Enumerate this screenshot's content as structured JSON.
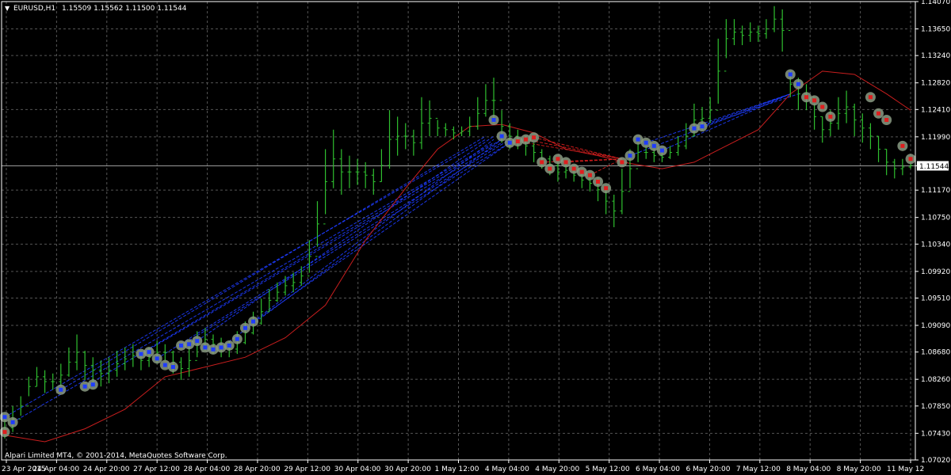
{
  "header": {
    "symbol": "EURUSD,H1",
    "ohlc": "1.15509 1.15562 1.11500 1.11544"
  },
  "footer": {
    "copyright": "Alpari Limited MT4, © 2001-2014, MetaQuotes Software Corp."
  },
  "colors": {
    "background": "#000000",
    "grid": "#555555",
    "bull_bar": "#2fbf2f",
    "bear_bar": "#2fbf2f",
    "envelope": "#c81e1e",
    "buy_marker": "#1e3cff",
    "sell_marker": "#e01e1e",
    "marker_halo": "#8a9a82",
    "current_price_box": "#ffffff"
  },
  "chart_data": {
    "type": "line",
    "symbol": "EURUSD",
    "timeframe": "H1",
    "current_price": 1.11544,
    "ylim": [
      1.0702,
      1.1407
    ],
    "y_ticks": [
      "1.14070",
      "1.13650",
      "1.13240",
      "1.12820",
      "1.12410",
      "1.11990",
      "1.11544",
      "1.11170",
      "1.10750",
      "1.10340",
      "1.09920",
      "1.09510",
      "1.09090",
      "1.08680",
      "1.08260",
      "1.07850",
      "1.07430",
      "1.07020"
    ],
    "x_ticks": [
      "23 Apr 2015",
      "24 Apr 04:00",
      "24 Apr 20:00",
      "27 Apr 12:00",
      "28 Apr 04:00",
      "28 Apr 20:00",
      "29 Apr 12:00",
      "30 Apr 04:00",
      "30 Apr 20:00",
      "1 May 12:00",
      "4 May 04:00",
      "4 May 20:00",
      "5 May 12:00",
      "6 May 04:00",
      "6 May 20:00",
      "7 May 12:00",
      "8 May 04:00",
      "8 May 20:00",
      "11 May 12"
    ],
    "series": [
      {
        "kind": "price_hl",
        "values": [
          [
            0,
            1.0768,
            1.0735
          ],
          [
            1,
            1.0785,
            1.0745
          ],
          [
            2,
            1.08,
            1.077
          ],
          [
            3,
            1.083,
            1.08
          ],
          [
            4,
            1.0845,
            1.0815
          ],
          [
            5,
            1.084,
            1.0805
          ],
          [
            6,
            1.0835,
            1.081
          ],
          [
            7,
            1.085,
            1.0815
          ],
          [
            8,
            1.0875,
            1.083
          ],
          [
            9,
            1.0895,
            1.084
          ],
          [
            10,
            1.087,
            1.0825
          ],
          [
            11,
            1.086,
            1.082
          ],
          [
            12,
            1.0855,
            1.0815
          ],
          [
            13,
            1.086,
            1.082
          ],
          [
            14,
            1.087,
            1.083
          ],
          [
            15,
            1.0875,
            1.084
          ],
          [
            16,
            1.088,
            1.0845
          ],
          [
            17,
            1.087,
            1.084
          ],
          [
            18,
            1.0875,
            1.0845
          ],
          [
            19,
            1.0885,
            1.085
          ],
          [
            20,
            1.088,
            1.0855
          ],
          [
            21,
            1.087,
            1.0835
          ],
          [
            22,
            1.086,
            1.0825
          ],
          [
            23,
            1.088,
            1.083
          ],
          [
            24,
            1.09,
            1.086
          ],
          [
            25,
            1.0905,
            1.087
          ],
          [
            26,
            1.0895,
            1.0865
          ],
          [
            27,
            1.089,
            1.086
          ],
          [
            28,
            1.0885,
            1.086
          ],
          [
            29,
            1.09,
            1.0865
          ],
          [
            30,
            1.0915,
            1.088
          ],
          [
            31,
            1.093,
            1.0895
          ],
          [
            32,
            1.095,
            1.091
          ],
          [
            33,
            1.0965,
            1.093
          ],
          [
            34,
            1.0975,
            1.0945
          ],
          [
            35,
            1.0985,
            1.0955
          ],
          [
            36,
            1.099,
            1.096
          ],
          [
            37,
            1.1,
            1.097
          ],
          [
            38,
            1.104,
            1.099
          ],
          [
            39,
            1.11,
            1.103
          ],
          [
            40,
            1.118,
            1.108
          ],
          [
            41,
            1.121,
            1.112
          ],
          [
            42,
            1.118,
            1.111
          ],
          [
            43,
            1.117,
            1.112
          ],
          [
            44,
            1.1165,
            1.1125
          ],
          [
            45,
            1.116,
            1.112
          ],
          [
            46,
            1.115,
            1.111
          ],
          [
            47,
            1.118,
            1.113
          ],
          [
            48,
            1.124,
            1.115
          ],
          [
            49,
            1.123,
            1.117
          ],
          [
            50,
            1.122,
            1.118
          ],
          [
            51,
            1.121,
            1.117
          ],
          [
            52,
            1.126,
            1.118
          ],
          [
            53,
            1.1255,
            1.12
          ],
          [
            54,
            1.1225,
            1.12
          ],
          [
            55,
            1.122,
            1.12
          ],
          [
            56,
            1.1215,
            1.1195
          ],
          [
            57,
            1.1215,
            1.12
          ],
          [
            58,
            1.123,
            1.12
          ],
          [
            59,
            1.126,
            1.121
          ],
          [
            60,
            1.128,
            1.123
          ],
          [
            61,
            1.129,
            1.122
          ],
          [
            62,
            1.124,
            1.119
          ],
          [
            63,
            1.122,
            1.118
          ],
          [
            64,
            1.121,
            1.118
          ],
          [
            65,
            1.12,
            1.117
          ],
          [
            66,
            1.119,
            1.116
          ],
          [
            67,
            1.118,
            1.115
          ],
          [
            68,
            1.117,
            1.114
          ],
          [
            69,
            1.116,
            1.113
          ],
          [
            70,
            1.116,
            1.1135
          ],
          [
            71,
            1.115,
            1.113
          ],
          [
            72,
            1.1145,
            1.112
          ],
          [
            73,
            1.114,
            1.1115
          ],
          [
            74,
            1.1135,
            1.11
          ],
          [
            75,
            1.112,
            1.108
          ],
          [
            76,
            1.111,
            1.106
          ],
          [
            77,
            1.115,
            1.108
          ],
          [
            78,
            1.118,
            1.112
          ],
          [
            79,
            1.119,
            1.116
          ],
          [
            80,
            1.1185,
            1.1165
          ],
          [
            81,
            1.118,
            1.116
          ],
          [
            82,
            1.1175,
            1.116
          ],
          [
            83,
            1.1185,
            1.1165
          ],
          [
            84,
            1.12,
            1.117
          ],
          [
            85,
            1.122,
            1.118
          ],
          [
            86,
            1.125,
            1.12
          ],
          [
            87,
            1.1245,
            1.121
          ],
          [
            88,
            1.126,
            1.122
          ],
          [
            89,
            1.135,
            1.125
          ],
          [
            90,
            1.138,
            1.132
          ],
          [
            91,
            1.138,
            1.134
          ],
          [
            92,
            1.137,
            1.134
          ],
          [
            93,
            1.1375,
            1.1345
          ],
          [
            94,
            1.137,
            1.1345
          ],
          [
            95,
            1.138,
            1.135
          ],
          [
            96,
            1.14,
            1.136
          ],
          [
            97,
            1.1395,
            1.133
          ],
          [
            98,
            1.13,
            1.126
          ],
          [
            99,
            1.129,
            1.124
          ],
          [
            100,
            1.128,
            1.124
          ],
          [
            101,
            1.125,
            1.121
          ],
          [
            102,
            1.123,
            1.119
          ],
          [
            103,
            1.124,
            1.12
          ],
          [
            104,
            1.126,
            1.121
          ],
          [
            105,
            1.127,
            1.122
          ],
          [
            106,
            1.125,
            1.12
          ],
          [
            107,
            1.1235,
            1.119
          ],
          [
            108,
            1.122,
            1.118
          ],
          [
            109,
            1.12,
            1.116
          ],
          [
            110,
            1.118,
            1.114
          ],
          [
            111,
            1.1165,
            1.1135
          ],
          [
            112,
            1.1165,
            1.114
          ],
          [
            113,
            1.116,
            1.115
          ]
        ]
      }
    ],
    "envelope": [
      [
        0,
        1.074
      ],
      [
        5,
        1.073
      ],
      [
        10,
        1.075
      ],
      [
        15,
        1.078
      ],
      [
        20,
        1.083
      ],
      [
        25,
        1.0845
      ],
      [
        30,
        1.086
      ],
      [
        35,
        1.089
      ],
      [
        40,
        1.094
      ],
      [
        45,
        1.104
      ],
      [
        50,
        1.112
      ],
      [
        54,
        1.118
      ],
      [
        58,
        1.1215
      ],
      [
        62,
        1.1218
      ],
      [
        66,
        1.1205
      ],
      [
        70,
        1.118
      ],
      [
        74,
        1.117
      ],
      [
        78,
        1.1158
      ],
      [
        82,
        1.115
      ],
      [
        86,
        1.116
      ],
      [
        90,
        1.1185
      ],
      [
        94,
        1.121
      ],
      [
        98,
        1.1265
      ],
      [
        102,
        1.13
      ],
      [
        106,
        1.1295
      ],
      [
        110,
        1.1265
      ],
      [
        113,
        1.124
      ]
    ],
    "markers": [
      {
        "type": "buy",
        "x": 0,
        "y": 1.0768
      },
      {
        "type": "sell",
        "x": 0,
        "y": 1.0745
      },
      {
        "type": "buy",
        "x": 1,
        "y": 1.076
      },
      {
        "type": "buy",
        "x": 7,
        "y": 1.081
      },
      {
        "type": "buy",
        "x": 10,
        "y": 1.0815
      },
      {
        "type": "buy",
        "x": 11,
        "y": 1.0818
      },
      {
        "type": "buy",
        "x": 17,
        "y": 1.0865
      },
      {
        "type": "buy",
        "x": 18,
        "y": 1.0868
      },
      {
        "type": "buy",
        "x": 19,
        "y": 1.0858
      },
      {
        "type": "buy",
        "x": 20,
        "y": 1.0848
      },
      {
        "type": "buy",
        "x": 21,
        "y": 1.0845
      },
      {
        "type": "buy",
        "x": 22,
        "y": 1.0878
      },
      {
        "type": "buy",
        "x": 23,
        "y": 1.088
      },
      {
        "type": "buy",
        "x": 24,
        "y": 1.0885
      },
      {
        "type": "buy",
        "x": 25,
        "y": 1.0875
      },
      {
        "type": "buy",
        "x": 26,
        "y": 1.0872
      },
      {
        "type": "buy",
        "x": 27,
        "y": 1.0875
      },
      {
        "type": "buy",
        "x": 28,
        "y": 1.0878
      },
      {
        "type": "buy",
        "x": 29,
        "y": 1.0888
      },
      {
        "type": "buy",
        "x": 30,
        "y": 1.0905
      },
      {
        "type": "buy",
        "x": 31,
        "y": 1.0915
      },
      {
        "type": "buy",
        "x": 61,
        "y": 1.1225
      },
      {
        "type": "buy",
        "x": 62,
        "y": 1.12
      },
      {
        "type": "buy",
        "x": 63,
        "y": 1.119
      },
      {
        "type": "sell",
        "x": 64,
        "y": 1.1192
      },
      {
        "type": "sell",
        "x": 65,
        "y": 1.1195
      },
      {
        "type": "sell",
        "x": 66,
        "y": 1.1198
      },
      {
        "type": "sell",
        "x": 67,
        "y": 1.116
      },
      {
        "type": "sell",
        "x": 68,
        "y": 1.115
      },
      {
        "type": "sell",
        "x": 69,
        "y": 1.1165
      },
      {
        "type": "sell",
        "x": 70,
        "y": 1.116
      },
      {
        "type": "sell",
        "x": 71,
        "y": 1.115
      },
      {
        "type": "sell",
        "x": 72,
        "y": 1.1145
      },
      {
        "type": "sell",
        "x": 73,
        "y": 1.114
      },
      {
        "type": "sell",
        "x": 74,
        "y": 1.113
      },
      {
        "type": "sell",
        "x": 75,
        "y": 1.112
      },
      {
        "type": "sell",
        "x": 77,
        "y": 1.116
      },
      {
        "type": "buy",
        "x": 78,
        "y": 1.117
      },
      {
        "type": "buy",
        "x": 79,
        "y": 1.1195
      },
      {
        "type": "buy",
        "x": 80,
        "y": 1.119
      },
      {
        "type": "buy",
        "x": 81,
        "y": 1.1185
      },
      {
        "type": "buy",
        "x": 82,
        "y": 1.1178
      },
      {
        "type": "buy",
        "x": 86,
        "y": 1.1212
      },
      {
        "type": "buy",
        "x": 87,
        "y": 1.1215
      },
      {
        "type": "buy",
        "x": 98,
        "y": 1.1295
      },
      {
        "type": "buy",
        "x": 99,
        "y": 1.128
      },
      {
        "type": "sell",
        "x": 100,
        "y": 1.126
      },
      {
        "type": "sell",
        "x": 101,
        "y": 1.1255
      },
      {
        "type": "sell",
        "x": 102,
        "y": 1.1245
      },
      {
        "type": "sell",
        "x": 103,
        "y": 1.123
      },
      {
        "type": "sell",
        "x": 108,
        "y": 1.126
      },
      {
        "type": "sell",
        "x": 109,
        "y": 1.1235
      },
      {
        "type": "sell",
        "x": 110,
        "y": 1.1225
      },
      {
        "type": "sell",
        "x": 112,
        "y": 1.1185
      },
      {
        "type": "sell",
        "x": 113,
        "y": 1.1165
      }
    ],
    "connectors": [
      {
        "type": "buy",
        "from": [
          0,
          1.0768
        ],
        "to": [
          60,
          1.1195
        ]
      },
      {
        "type": "buy",
        "from": [
          1,
          1.076
        ],
        "to": [
          61,
          1.119
        ]
      },
      {
        "type": "buy",
        "from": [
          7,
          1.081
        ],
        "to": [
          60,
          1.12
        ]
      },
      {
        "type": "buy",
        "from": [
          10,
          1.0815
        ],
        "to": [
          62,
          1.1195
        ]
      },
      {
        "type": "buy",
        "from": [
          17,
          1.0865
        ],
        "to": [
          62,
          1.119
        ]
      },
      {
        "type": "buy",
        "from": [
          19,
          1.0858
        ],
        "to": [
          63,
          1.1195
        ]
      },
      {
        "type": "buy",
        "from": [
          22,
          1.0878
        ],
        "to": [
          63,
          1.119
        ]
      },
      {
        "type": "buy",
        "from": [
          24,
          1.0885
        ],
        "to": [
          61,
          1.12
        ]
      },
      {
        "type": "buy",
        "from": [
          27,
          1.0875
        ],
        "to": [
          62,
          1.1195
        ]
      },
      {
        "type": "buy",
        "from": [
          30,
          1.0905
        ],
        "to": [
          63,
          1.119
        ]
      },
      {
        "type": "buy",
        "from": [
          31,
          1.0915
        ],
        "to": [
          61,
          1.1195
        ]
      },
      {
        "type": "buy",
        "from": [
          78,
          1.117
        ],
        "to": [
          98,
          1.1265
        ]
      },
      {
        "type": "buy",
        "from": [
          80,
          1.119
        ],
        "to": [
          98,
          1.1265
        ]
      },
      {
        "type": "buy",
        "from": [
          82,
          1.1178
        ],
        "to": [
          98,
          1.1265
        ]
      },
      {
        "type": "buy",
        "from": [
          86,
          1.1212
        ],
        "to": [
          98,
          1.1265
        ]
      },
      {
        "type": "buy",
        "from": [
          87,
          1.1215
        ],
        "to": [
          99,
          1.1265
        ]
      },
      {
        "type": "sell",
        "from": [
          64,
          1.1192
        ],
        "to": [
          77,
          1.1165
        ]
      },
      {
        "type": "sell",
        "from": [
          65,
          1.1195
        ],
        "to": [
          77,
          1.1165
        ]
      },
      {
        "type": "sell",
        "from": [
          66,
          1.1198
        ],
        "to": [
          77,
          1.1165
        ]
      },
      {
        "type": "sell",
        "from": [
          67,
          1.116
        ],
        "to": [
          77,
          1.1165
        ]
      },
      {
        "type": "sell",
        "from": [
          70,
          1.116
        ],
        "to": [
          77,
          1.1165
        ]
      },
      {
        "type": "sell",
        "from": [
          73,
          1.114
        ],
        "to": [
          77,
          1.1165
        ]
      }
    ]
  }
}
